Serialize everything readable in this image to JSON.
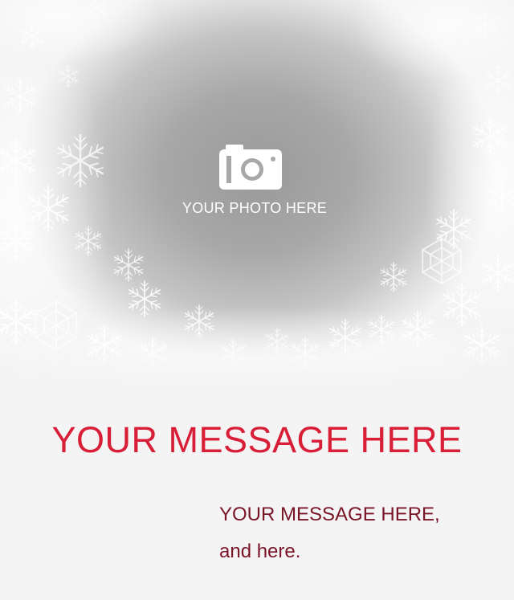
{
  "photo_placeholder": {
    "icon": "camera-icon",
    "label": "YOUR PHOTO HERE"
  },
  "headline": "YOUR MESSAGE HERE",
  "message": {
    "line1": "YOUR MESSAGE HERE,",
    "line2": "and here."
  },
  "colors": {
    "headline": "#d81f37",
    "message": "#7a1427",
    "photo_zone": "#a8a8a8",
    "background": "#f4f4f4"
  }
}
